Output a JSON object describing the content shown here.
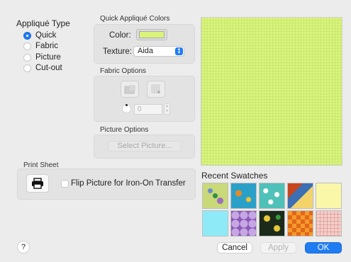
{
  "applique_type": {
    "title": "Appliqué Type",
    "options": [
      {
        "label": "Quick",
        "selected": true
      },
      {
        "label": "Fabric",
        "selected": false
      },
      {
        "label": "Picture",
        "selected": false
      },
      {
        "label": "Cut-out",
        "selected": false
      }
    ]
  },
  "quick_colors": {
    "title": "Quick Appliqué Colors",
    "color_label": "Color:",
    "color_value": "#d9f479",
    "texture_label": "Texture:",
    "texture_value": "Aida"
  },
  "fabric_options": {
    "title": "Fabric Options",
    "stepper_value": "0"
  },
  "picture_options": {
    "title": "Picture Options",
    "select_button": "Select Picture..."
  },
  "print_sheet": {
    "title": "Print Sheet",
    "flip_label": "Flip Picture for Iron-On Transfer"
  },
  "recent_swatches": {
    "title": "Recent Swatches"
  },
  "buttons": {
    "help": "?",
    "cancel": "Cancel",
    "apply": "Apply",
    "ok": "OK"
  },
  "colors": {
    "accent": "#1f7cf3",
    "preview": "#daf57d"
  }
}
